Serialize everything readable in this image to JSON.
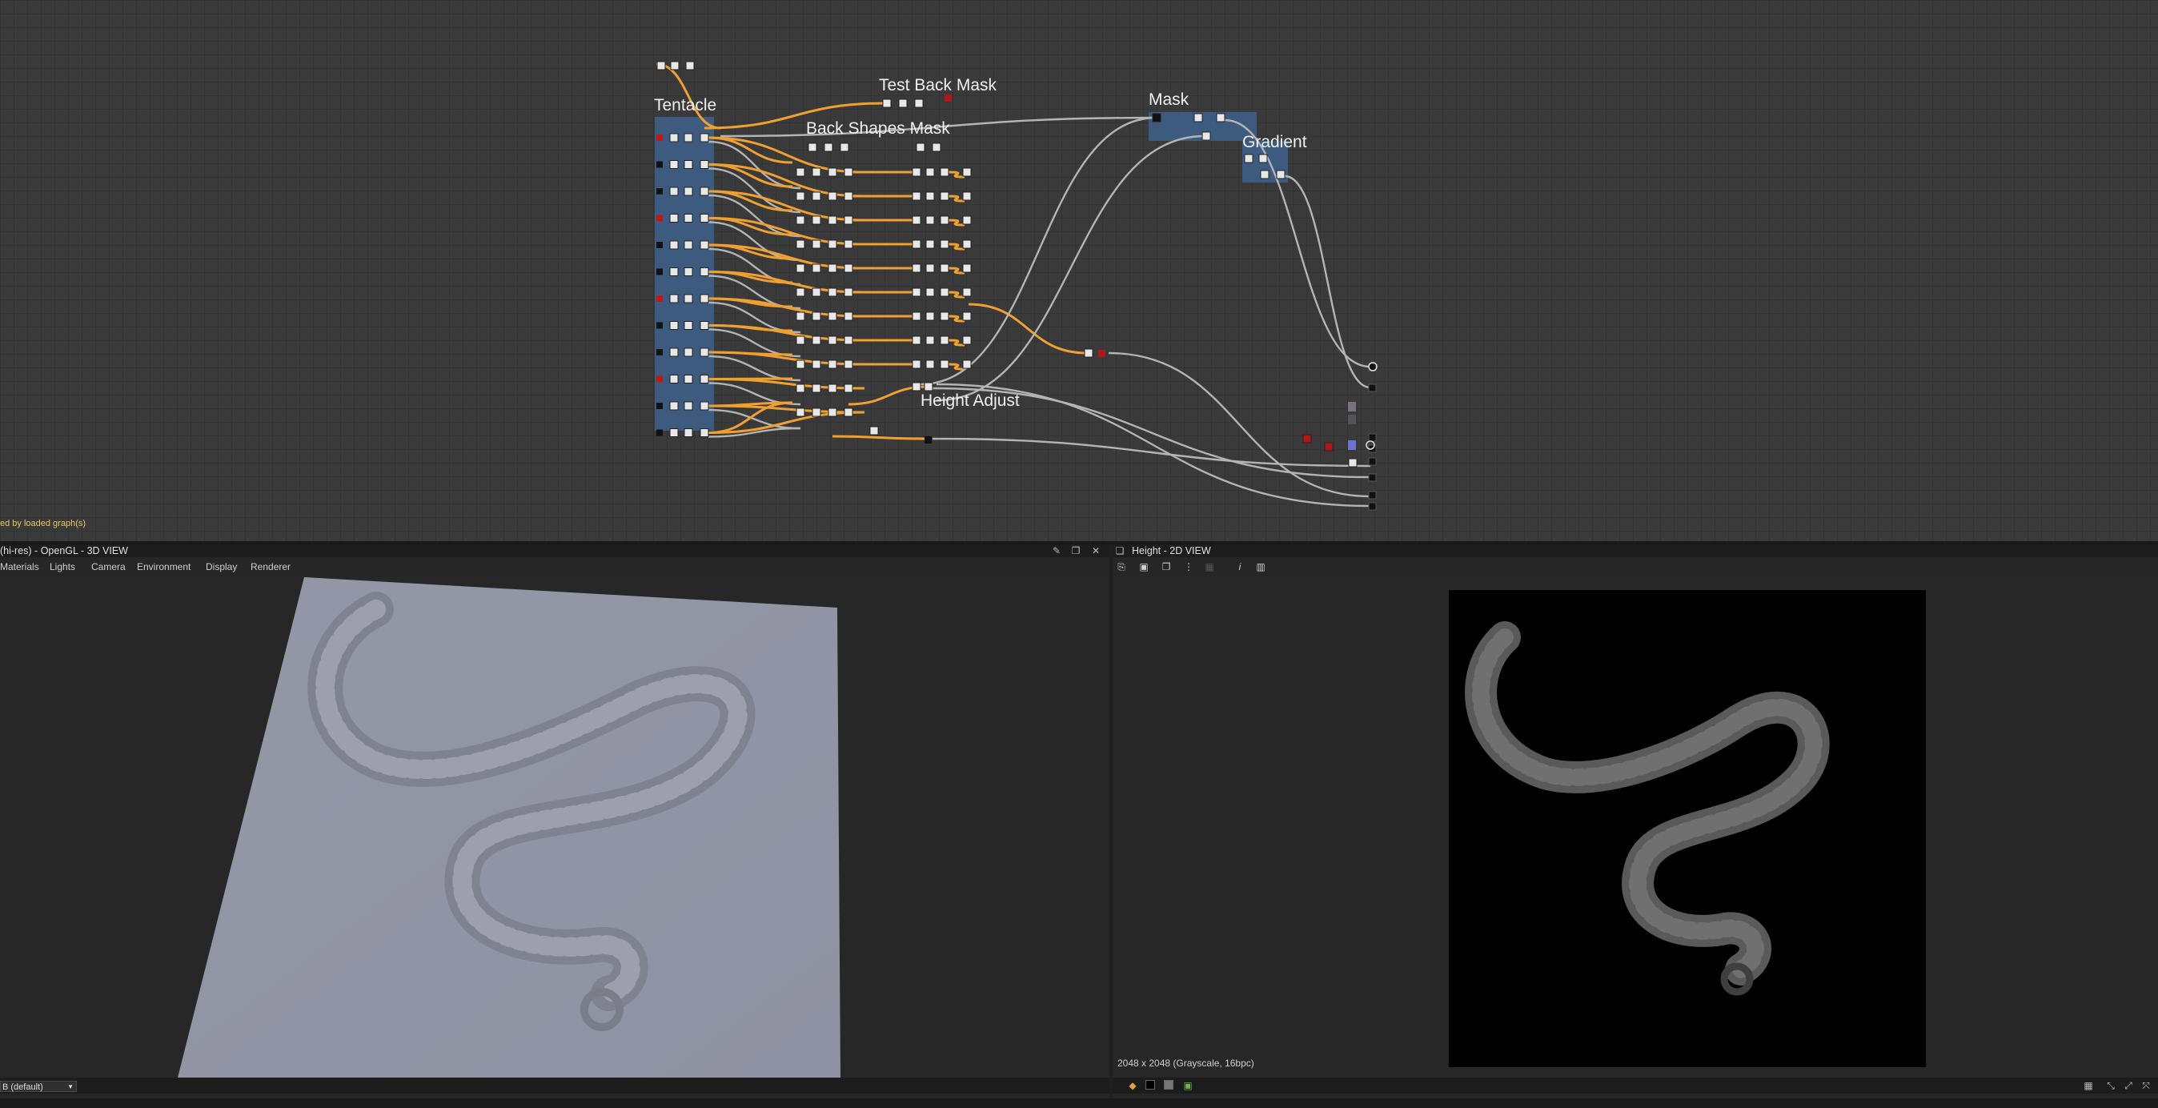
{
  "graph": {
    "frames": {
      "tentacle": "Tentacle",
      "test_back_mask": "Test Back Mask",
      "back_shapes_mask": "Back Shapes Mask",
      "mask": "Mask",
      "gradient": "Gradient",
      "height_adjust": "Height Adjust"
    },
    "status_message": "ed by loaded graph(s)"
  },
  "view3d": {
    "title": "(hi-res) - OpenGL - 3D VIEW",
    "menu": [
      "Materials",
      "Lights",
      "Camera",
      "Environment",
      "Display",
      "Renderer"
    ],
    "env_select": "B (default)"
  },
  "view2d": {
    "title": "Height - 2D VIEW",
    "image_info": "2048 x 2048 (Grayscale, 16bpc)"
  },
  "colors": {
    "wire_orange": "#f0a030",
    "wire_gray": "#b4b4b4",
    "frame_blue": "#3d5f86"
  }
}
